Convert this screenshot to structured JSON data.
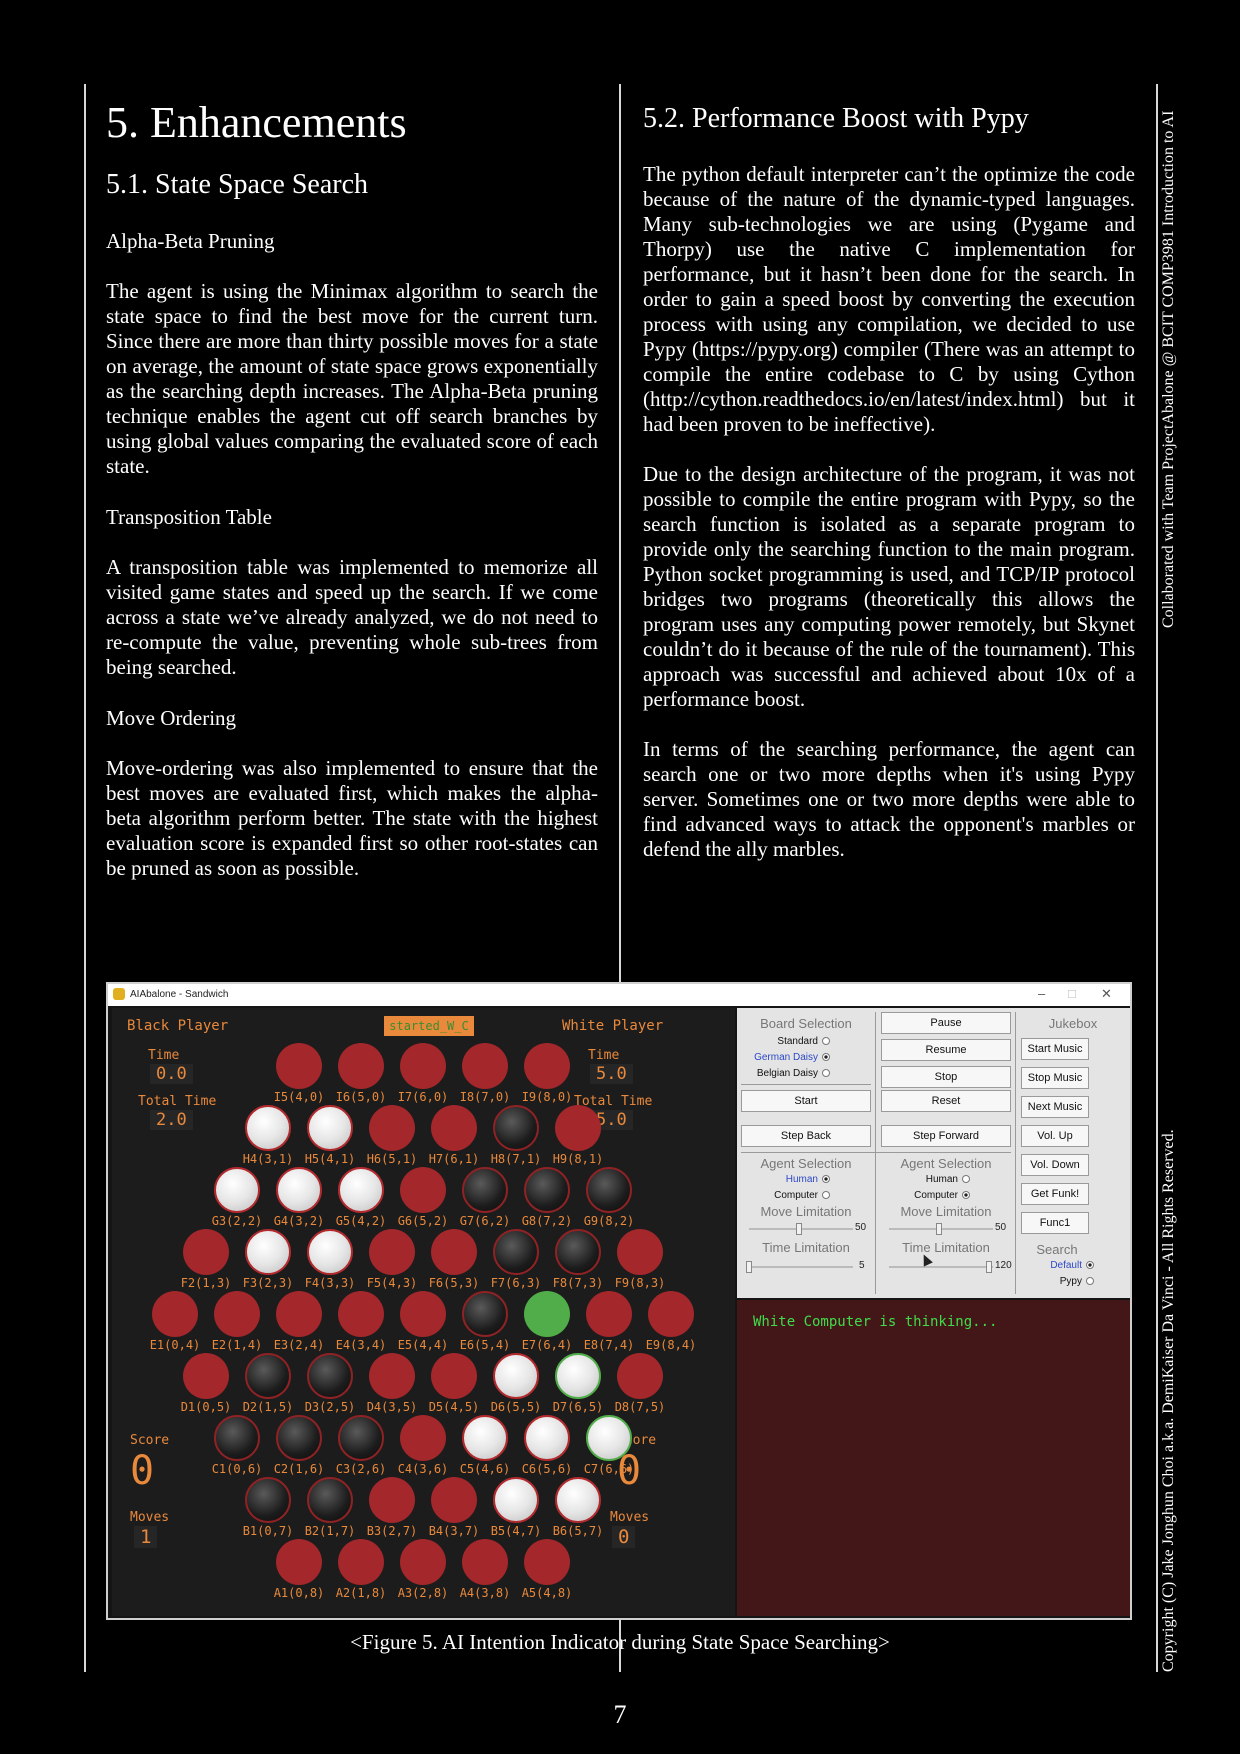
{
  "section": {
    "title": "5. Enhancements",
    "subsection1": {
      "title": "5.1. State Space Search",
      "heading_alpha": "Alpha-Beta Pruning",
      "para_alpha": "The agent is using the Minimax algorithm to search the state space to find the best move for the current turn. Since there are more than thirty possible moves for a state on average, the amount of state space grows exponentially as the searching depth increases. The Alpha-Beta pruning technique enables the agent cut off search branches by using global values comparing the evaluated score of each state.",
      "heading_tt": "Transposition Table",
      "para_tt": "A transposition table was implemented to memorize all visited game states and speed up the search. If we come across a state we’ve already analyzed, we do not need to re-compute the value, preventing whole sub-trees from being searched.",
      "heading_mo": "Move Ordering",
      "para_mo": "Move-ordering was also implemented to ensure that the best moves are evaluated first, which makes the alpha-beta algorithm perform better. The state with the highest evaluation score is expanded first so other root-states can be pruned as soon as possible."
    },
    "subsection2": {
      "title": "5.2. Performance Boost with Pypy",
      "para1": "The python default interpreter can’t the optimize the code because of the nature of the dynamic-typed languages. Many sub-technologies we are using (Pygame and Thorpy) use the native C implementation for performance, but it hasn’t been done for the search. In order to gain a speed boost by converting the execution process with using any compilation, we decided to use Pypy (https://pypy.org) compiler (There was an attempt to compile the entire codebase to C by using Cython (http://cython.readthedocs.io/en/latest/index.html) but it had been proven to be ineffective).",
      "para2": "Due to the design architecture of the program, it was not possible to compile the entire program with Pypy, so the search function is isolated as a separate program to provide only the searching function to the main program. Python socket programming is used, and TCP/IP protocol bridges two programs (theoretically this allows the program uses any computing power remotely, but Skynet couldn’t do it because of the rule of the tournament). This approach was successful and achieved about 10x of a performance boost.",
      "para3": "In terms of the searching performance, the agent can search one or two more depths when it's using Pypy server. Sometimes one or two more depths were able to find advanced ways to attack the opponent's marbles or defend the ally marbles."
    }
  },
  "sidebar": {
    "top": "Collaborated with Team ProjectAbalone @ BCIT COMP3981 Introduction to AI",
    "bottom": "Copyright (C) Jake Jonghun Choi a.k.a. DemiKaiser Da Vinci - All Rights Reserved."
  },
  "figure": {
    "window_title": "AIAbalone - Sandwich",
    "status": "started_W_C",
    "black": {
      "label": "Black Player",
      "time_label": "Time",
      "time": "0.0",
      "total_label": "Total Time",
      "total": "2.0",
      "score_label": "Score",
      "score": "0",
      "moves_label": "Moves",
      "moves": "1"
    },
    "white": {
      "label": "White Player",
      "time_label": "Time",
      "time": "5.0",
      "total_label": "Total Time",
      "total": "5.0",
      "score_label": "Score",
      "score": "0",
      "moves_label": "Moves",
      "moves": "0"
    },
    "board_rows": [
      {
        "cells": [
          [
            "I5(4,0)",
            "r"
          ],
          [
            "I6(5,0)",
            "r"
          ],
          [
            "I7(6,0)",
            "r"
          ],
          [
            "I8(7,0)",
            "r"
          ],
          [
            "I9(8,0)",
            "r"
          ]
        ]
      },
      {
        "cells": [
          [
            "H4(3,1)",
            "w"
          ],
          [
            "H5(4,1)",
            "w"
          ],
          [
            "H6(5,1)",
            "r"
          ],
          [
            "H7(6,1)",
            "r"
          ],
          [
            "H8(7,1)",
            "b"
          ],
          [
            "H9(8,1)",
            "r"
          ]
        ]
      },
      {
        "cells": [
          [
            "G3(2,2)",
            "w"
          ],
          [
            "G4(3,2)",
            "w"
          ],
          [
            "G5(4,2)",
            "w"
          ],
          [
            "G6(5,2)",
            "r"
          ],
          [
            "G7(6,2)",
            "b"
          ],
          [
            "G8(7,2)",
            "b"
          ],
          [
            "G9(8,2)",
            "b"
          ]
        ]
      },
      {
        "cells": [
          [
            "F2(1,3)",
            "r"
          ],
          [
            "F3(2,3)",
            "w"
          ],
          [
            "F4(3,3)",
            "w"
          ],
          [
            "F5(4,3)",
            "r"
          ],
          [
            "F6(5,3)",
            "r"
          ],
          [
            "F7(6,3)",
            "b"
          ],
          [
            "F8(7,3)",
            "b"
          ],
          [
            "F9(8,3)",
            "r"
          ]
        ]
      },
      {
        "cells": [
          [
            "E1(0,4)",
            "r"
          ],
          [
            "E2(1,4)",
            "r"
          ],
          [
            "E3(2,4)",
            "r"
          ],
          [
            "E4(3,4)",
            "r"
          ],
          [
            "E5(4,4)",
            "r"
          ],
          [
            "E6(5,4)",
            "b"
          ],
          [
            "E7(6,4)",
            "g"
          ],
          [
            "E8(7,4)",
            "r"
          ],
          [
            "E9(8,4)",
            "r"
          ]
        ]
      },
      {
        "cells": [
          [
            "D1(0,5)",
            "r"
          ],
          [
            "D2(1,5)",
            "b"
          ],
          [
            "D3(2,5)",
            "b"
          ],
          [
            "D4(3,5)",
            "r"
          ],
          [
            "D5(4,5)",
            "r"
          ],
          [
            "D6(5,5)",
            "w"
          ],
          [
            "D7(6,5)",
            "wh"
          ],
          [
            "D8(7,5)",
            "r"
          ]
        ]
      },
      {
        "cells": [
          [
            "C1(0,6)",
            "b"
          ],
          [
            "C2(1,6)",
            "b"
          ],
          [
            "C3(2,6)",
            "b"
          ],
          [
            "C4(3,6)",
            "r"
          ],
          [
            "C5(4,6)",
            "w"
          ],
          [
            "C6(5,6)",
            "w"
          ],
          [
            "C7(6,6)",
            "wh"
          ]
        ]
      },
      {
        "cells": [
          [
            "B1(0,7)",
            "b"
          ],
          [
            "B2(1,7)",
            "b"
          ],
          [
            "B3(2,7)",
            "r"
          ],
          [
            "B4(3,7)",
            "r"
          ],
          [
            "B5(4,7)",
            "w"
          ],
          [
            "B6(5,7)",
            "w"
          ]
        ]
      },
      {
        "cells": [
          [
            "A1(0,8)",
            "r"
          ],
          [
            "A2(1,8)",
            "r"
          ],
          [
            "A3(2,8)",
            "r"
          ],
          [
            "A4(3,8)",
            "r"
          ],
          [
            "A5(4,8)",
            "r"
          ]
        ]
      }
    ],
    "controls": {
      "board_selection": "Board Selection",
      "board_options": [
        "Standard",
        "German Daisy",
        "Belgian Daisy"
      ],
      "board_selected": 1,
      "buttons_mid": [
        "Pause",
        "Resume",
        "Stop",
        "Reset"
      ],
      "start": "Start",
      "step_back": "Step Back",
      "step_forward": "Step Forward",
      "jukebox": "Jukebox",
      "jukebox_buttons": [
        "Start Music",
        "Stop Music",
        "Next Music",
        "Vol. Up",
        "Vol. Down",
        "Get Funk!",
        "Func1"
      ],
      "agent_selection": "Agent Selection",
      "agent_options": [
        "Human",
        "Computer"
      ],
      "black_agent_selected": 0,
      "white_agent_selected": 1,
      "move_limitation": "Move Limitation",
      "time_limitation": "Time Limitation",
      "black_move_limit": "50",
      "white_move_limit": "50",
      "black_time_limit": "5",
      "white_time_limit": "120",
      "black_move_fraction": 0.5,
      "white_move_fraction": 0.5,
      "black_time_fraction": 0.0,
      "white_time_fraction": 1.0,
      "search": "Search",
      "search_options": [
        "Default",
        "Pypy"
      ],
      "search_selected": 0
    },
    "log": "White Computer is thinking...",
    "colors": {
      "marble_red": "#a3272b",
      "accent_orange": "#e9893c",
      "log_bg": "#431718",
      "log_text": "#3fdc4b",
      "highlight_green": "#51ad49"
    }
  },
  "caption": "<Figure 5. AI Intention Indicator during State Space Searching>",
  "page_number": "7"
}
